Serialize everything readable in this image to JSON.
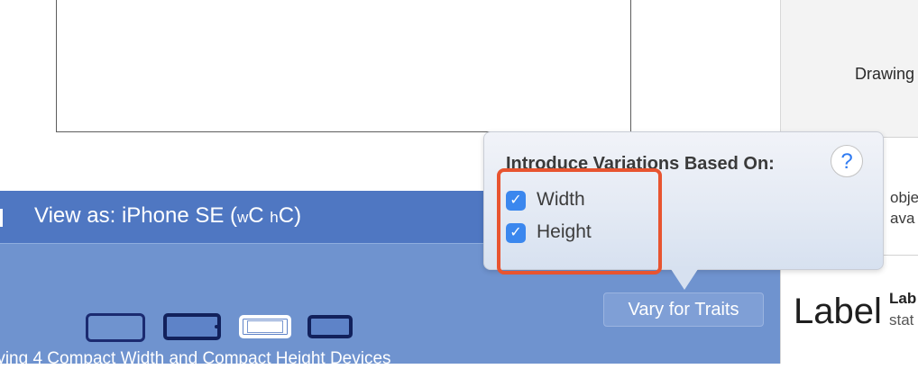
{
  "canvas": {
    "view_frame": "storyboard-view-frame"
  },
  "right_panel": {
    "drawing_label": "Drawing",
    "mid_text_line1": "obje",
    "mid_text_line2": "ava",
    "label_preview": "Label",
    "label_title": "Lab",
    "label_sub": "stat"
  },
  "device_bar": {
    "title_prefix": "View as: iPhone SE (",
    "title_w": "w",
    "title_C1": "C ",
    "title_h": "h",
    "title_C2": "C)",
    "status": "rying 4 Compact Width and Compact Height Devices",
    "vary_button": "Vary for Traits",
    "devices": [
      "iphone-landscape-outline-icon",
      "iphone-landscape-dark-icon",
      "iphone-landscape-white-icon",
      "iphone-landscape-small-icon"
    ]
  },
  "popover": {
    "title": "Introduce Variations Based On:",
    "help": "?",
    "options": [
      {
        "label": "Width",
        "checked": true,
        "check_glyph": "✓"
      },
      {
        "label": "Height",
        "checked": true,
        "check_glyph": "✓"
      }
    ]
  },
  "colors": {
    "bar_header": "#4f77c2",
    "bar_body": "#6f93cf",
    "checkbox": "#3b87ee",
    "highlight": "#e85430"
  }
}
